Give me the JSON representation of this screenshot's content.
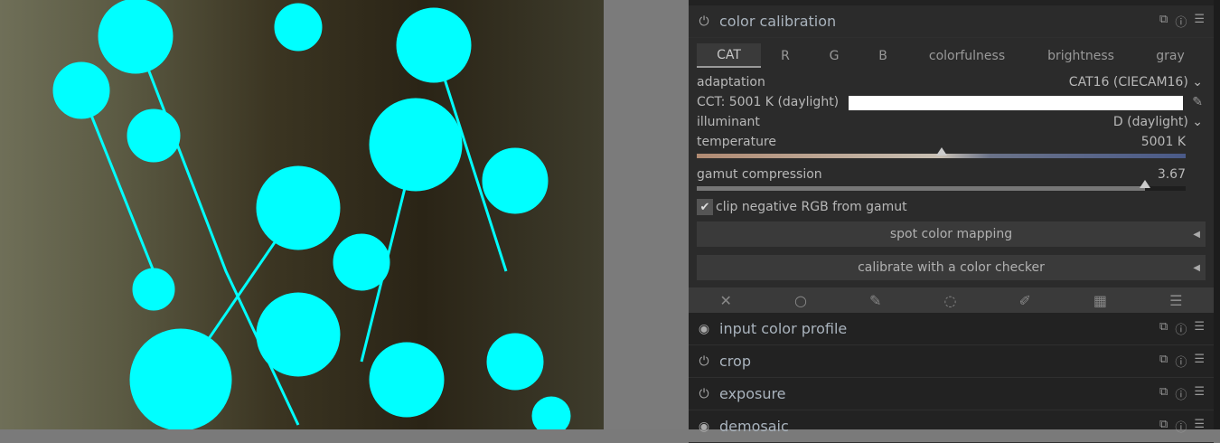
{
  "modules": {
    "active": {
      "name": "color calibration"
    },
    "tabs": [
      "CAT",
      "R",
      "G",
      "B",
      "colorfulness",
      "brightness",
      "gray"
    ],
    "adaptation": {
      "label": "adaptation",
      "value": "CAT16 (CIECAM16)"
    },
    "cct": {
      "label": "CCT: 5001 K (daylight)"
    },
    "illuminant": {
      "label": "illuminant",
      "value": "D (daylight)"
    },
    "temperature": {
      "label": "temperature",
      "value": "5001 K",
      "fraction": 0.5
    },
    "gamut": {
      "label": "gamut compression",
      "value": "3.67",
      "fraction": 0.917
    },
    "clip": {
      "label": "clip negative RGB from gamut",
      "checked": true
    },
    "spot": {
      "label": "spot color mapping"
    },
    "checker": {
      "label": "calibrate with a color checker"
    },
    "list": [
      {
        "name": "input color profile"
      },
      {
        "name": "crop"
      },
      {
        "name": "exposure"
      },
      {
        "name": "demosaic"
      }
    ]
  },
  "colors": {
    "overexposed": "#00ffff"
  }
}
